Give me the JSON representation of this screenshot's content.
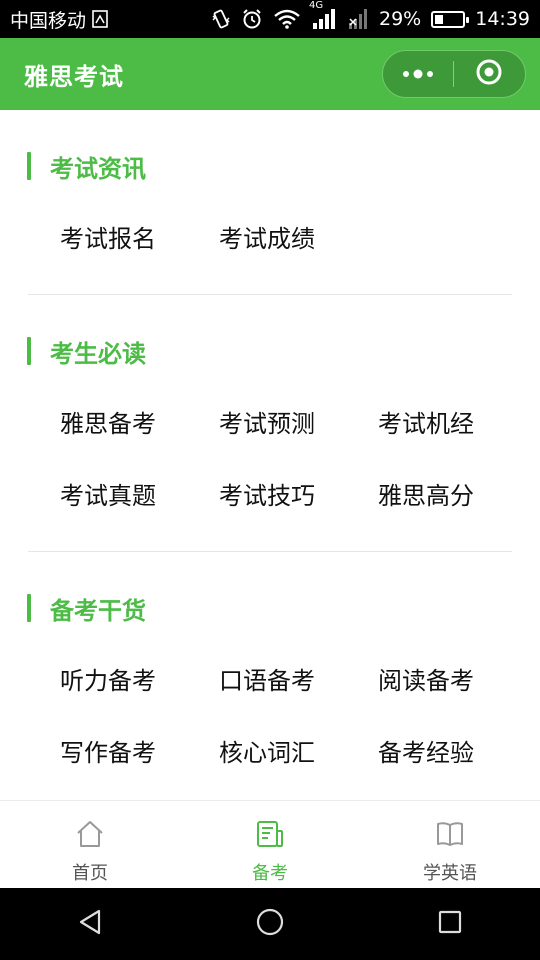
{
  "status_bar": {
    "carrier": "中国移动",
    "network": "4G",
    "battery_percent": "29%",
    "battery_level": 0.29,
    "time": "14:39",
    "icons": [
      "sim-card-icon",
      "vibrate-icon",
      "alarm-icon",
      "wifi-icon",
      "signal-icon"
    ]
  },
  "app": {
    "title": "雅思考试",
    "accent_color": "#4cbc46",
    "menu_icon": "more-dots-icon",
    "close_icon": "target-close-icon"
  },
  "sections": [
    {
      "title": "考试资讯",
      "items": [
        "考试报名",
        "考试成绩"
      ]
    },
    {
      "title": "考生必读",
      "items": [
        "雅思备考",
        "考试预测",
        "考试机经",
        "考试真题",
        "考试技巧",
        "雅思高分"
      ]
    },
    {
      "title": "备考干货",
      "items": [
        "听力备考",
        "口语备考",
        "阅读备考",
        "写作备考",
        "核心词汇",
        "备考经验"
      ]
    }
  ],
  "tabs": [
    {
      "label": "首页",
      "icon": "home-icon",
      "active": false
    },
    {
      "label": "备考",
      "icon": "notes-icon",
      "active": true
    },
    {
      "label": "学英语",
      "icon": "book-icon",
      "active": false
    }
  ],
  "nav_bar": {
    "icons": [
      "back-triangle-icon",
      "home-circle-icon",
      "recents-square-icon"
    ]
  }
}
